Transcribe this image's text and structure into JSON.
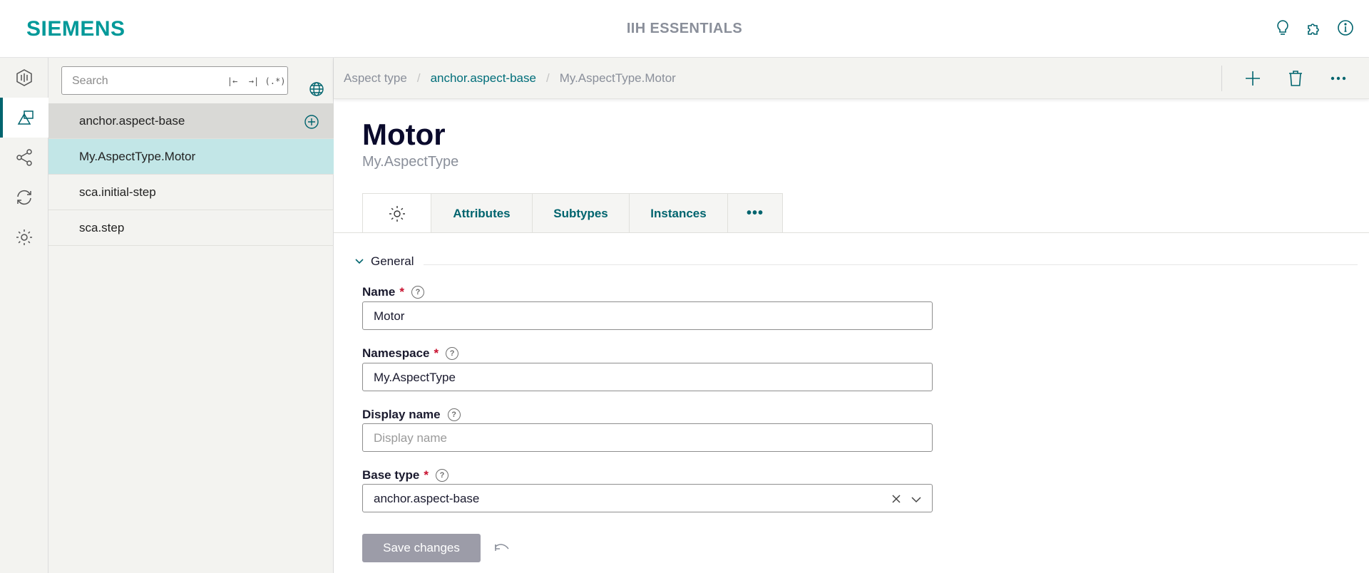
{
  "header": {
    "logo": "SIEMENS",
    "app_title": "IIH ESSENTIALS",
    "icons": [
      "lightbulb-icon",
      "puzzle-icon",
      "info-icon"
    ]
  },
  "rail": {
    "items": [
      {
        "name": "dashboard-icon",
        "active": false
      },
      {
        "name": "model-icon",
        "active": true
      },
      {
        "name": "connections-icon",
        "active": false
      },
      {
        "name": "sync-icon",
        "active": false
      },
      {
        "name": "settings-icon",
        "active": false
      }
    ]
  },
  "tree": {
    "search_placeholder": "Search",
    "search_tools": [
      "|←",
      "→|",
      "(.*)"
    ],
    "items": [
      {
        "label": "anchor.aspect-base",
        "kind": "header"
      },
      {
        "label": "My.AspectType.Motor",
        "kind": "selected"
      },
      {
        "label": "sca.initial-step",
        "kind": "normal"
      },
      {
        "label": "sca.step",
        "kind": "normal"
      }
    ]
  },
  "breadcrumb": {
    "items": [
      "Aspect type",
      "anchor.aspect-base",
      "My.AspectType.Motor"
    ]
  },
  "page": {
    "title": "Motor",
    "subtitle": "My.AspectType"
  },
  "tabs": [
    {
      "label": "",
      "icon": "gear-icon",
      "active": true
    },
    {
      "label": "Attributes",
      "active": false
    },
    {
      "label": "Subtypes",
      "active": false
    },
    {
      "label": "Instances",
      "active": false
    },
    {
      "label": "•••",
      "active": false
    }
  ],
  "section": {
    "title": "General"
  },
  "form": {
    "name_label": "Name",
    "name_value": "Motor",
    "namespace_label": "Namespace",
    "namespace_value": "My.AspectType",
    "display_label": "Display name",
    "display_placeholder": "Display name",
    "display_value": "",
    "base_label": "Base type",
    "base_value": "anchor.aspect-base",
    "required_mark": "*",
    "help_mark": "?"
  },
  "actions": {
    "save_label": "Save changes"
  },
  "colors": {
    "brand": "#009999",
    "accent": "#00646e",
    "selected_row": "#c2e6e7",
    "save_disabled": "#9c9ca8",
    "required": "#c8102e"
  }
}
